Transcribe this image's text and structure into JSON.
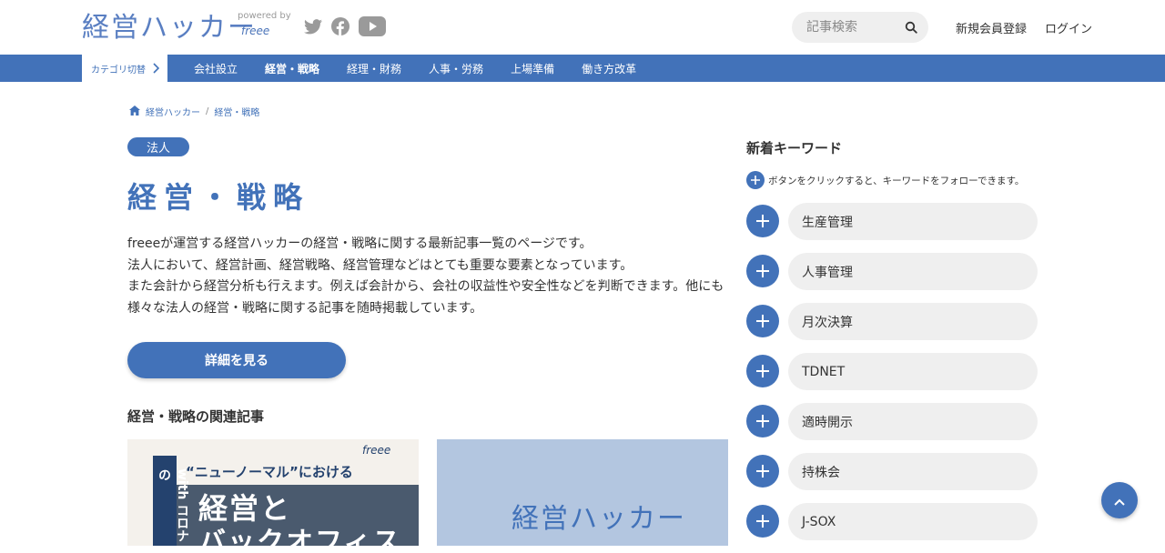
{
  "header": {
    "logo_text": "経営ハッカー",
    "powered_label": "powered by",
    "powered_brand": "freee",
    "search_placeholder": "記事検索",
    "signup_label": "新規会員登録",
    "login_label": "ログイン",
    "social_icons": [
      "twitter-icon",
      "facebook-icon",
      "youtube-icon"
    ]
  },
  "nav": {
    "category_switch": "カテゴリ切替",
    "items": [
      {
        "label": "会社設立"
      },
      {
        "label": "経営・戦略",
        "active": true
      },
      {
        "label": "経理・財務"
      },
      {
        "label": "人事・労務"
      },
      {
        "label": "上場準備"
      },
      {
        "label": "働き方改革"
      }
    ]
  },
  "breadcrumb": {
    "home": "経営ハッカー",
    "current": "経営・戦略"
  },
  "main": {
    "tag": "法人",
    "title": "経営・戦略",
    "description": [
      "freeeが運営する経営ハッカーの経営・戦略に関する最新記事一覧のページです。",
      "法人において、経営計画、経営戦略、経営管理などはとても重要な要素となっています。",
      "また会計から経営分析も行えます。例えば会計から、会社の収益性や安全性などを判断できます。他にも",
      "様々な法人の経営・戦略に関する記事を随時掲載しています。"
    ],
    "detail_button": "詳細を見る",
    "related_title": "経営・戦略の関連記事",
    "card1": {
      "vertical_text": "with コロナの",
      "quote": "“ニューノーマル”における",
      "line1": "経営と",
      "line2": "バックオフィス",
      "brand": "freee"
    },
    "card2": {
      "logo_text": "経営ハッカー"
    }
  },
  "sidebar": {
    "title": "新着キーワード",
    "note": "ボタンをクリックすると、キーワードをフォローできます。",
    "keywords": [
      "生産管理",
      "人事管理",
      "月次決算",
      "TDNET",
      "適時開示",
      "持株会",
      "J-SOX"
    ]
  },
  "colors": {
    "accent": "#4272b9",
    "pill_bg": "#efefef"
  }
}
